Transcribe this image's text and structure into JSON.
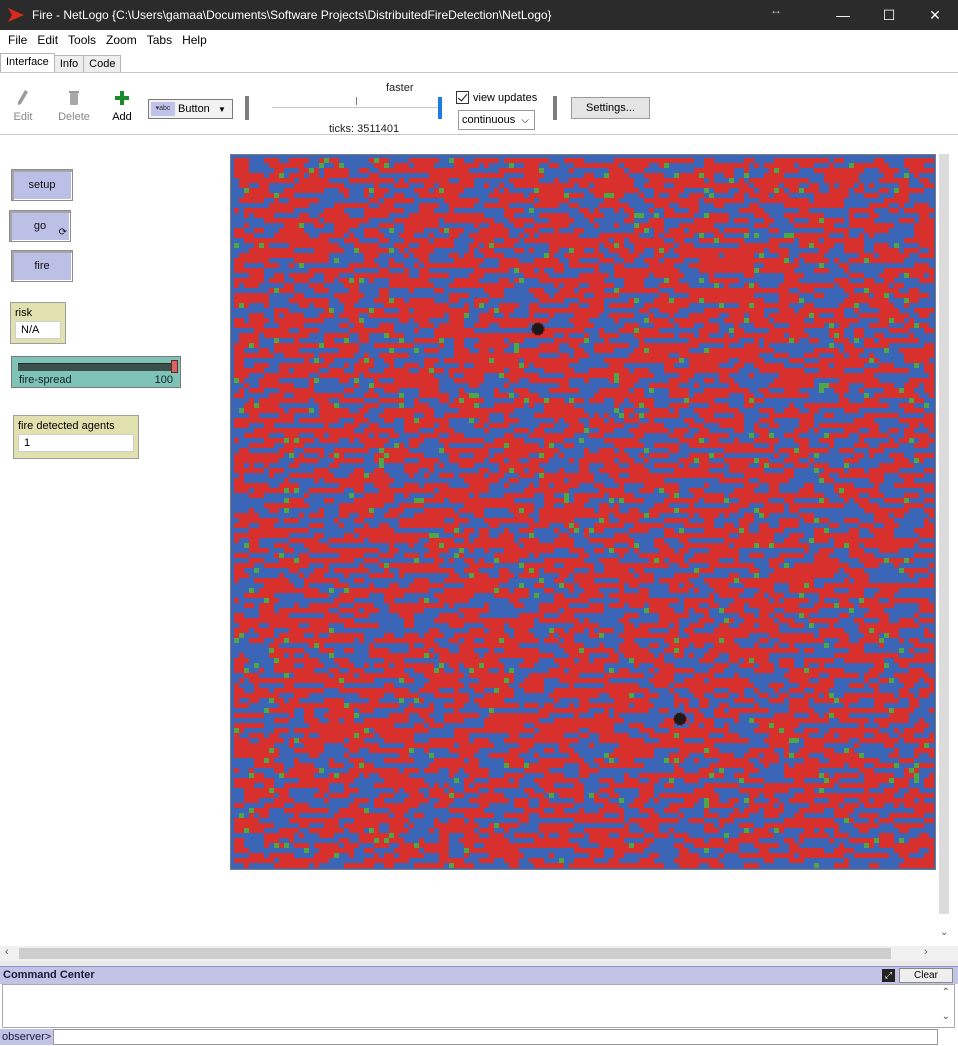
{
  "window": {
    "title": "Fire - NetLogo {C:\\Users\\gamaa\\Documents\\Software Projects\\DistribuitedFireDetection\\NetLogo}",
    "minimize": "—",
    "maximize": "☐",
    "close": "✕"
  },
  "menu": [
    "File",
    "Edit",
    "Tools",
    "Zoom",
    "Tabs",
    "Help"
  ],
  "tabs": [
    "Interface",
    "Info",
    "Code"
  ],
  "toolbar": {
    "edit_label": "Edit",
    "delete_label": "Delete",
    "add_label": "Add",
    "widget_type": "Button",
    "speed_label": "faster",
    "ticks_text": "ticks: 3511401",
    "view_updates_label": "view updates",
    "update_mode": "continuous",
    "settings_label": "Settings..."
  },
  "buttons": {
    "setup": "setup",
    "go": "go",
    "fire": "fire"
  },
  "monitors": {
    "risk_label": "risk",
    "risk_value": "N/A",
    "fire_detected_label": "fire detected agents",
    "fire_detected_value": "1"
  },
  "slider": {
    "label": "fire-spread",
    "value": "100",
    "fraction": 1.0
  },
  "world": {
    "colors": {
      "burning": "#d8302c",
      "water": "#3b66b8",
      "tree": "#4fa548",
      "agent": "#1a1a1a"
    },
    "agent_count": 2
  },
  "command_center": {
    "title": "Command Center",
    "clear_label": "Clear",
    "observer_label": "observer>"
  }
}
